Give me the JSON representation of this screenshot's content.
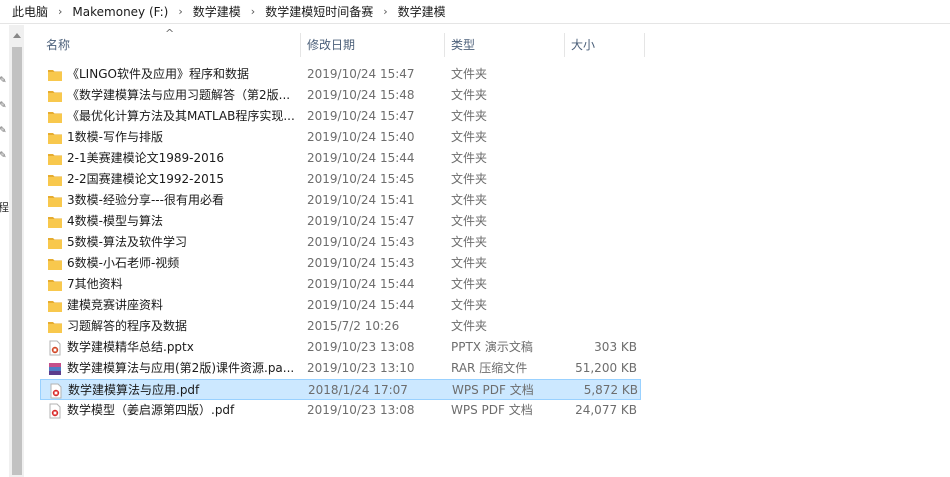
{
  "breadcrumb": {
    "items": [
      "此电脑",
      "Makemoney (F:)",
      "数学建模",
      "数学建模短时间备赛",
      "数学建模"
    ]
  },
  "side": {
    "partial_label": "程"
  },
  "columns": {
    "name": "名称",
    "modified": "修改日期",
    "type": "类型",
    "size": "大小"
  },
  "colors": {
    "folder": "#f8c84d",
    "folder_tab": "#e6ac2f",
    "selection_bg": "#cce8ff",
    "selection_border": "#99d1ff",
    "pdf_red": "#d92b2b",
    "rar_purple": "#5b3c8c",
    "header_text": "#4c607a"
  },
  "files": [
    {
      "icon": "folder-icon",
      "name": "《LINGO软件及应用》程序和数据",
      "modified": "2019/10/24 15:47",
      "type": "文件夹",
      "size": ""
    },
    {
      "icon": "folder-icon",
      "name": "《数学建模算法与应用习题解答（第2版...",
      "modified": "2019/10/24 15:48",
      "type": "文件夹",
      "size": ""
    },
    {
      "icon": "folder-icon",
      "name": "《最优化计算方法及其MATLAB程序实现...",
      "modified": "2019/10/24 15:47",
      "type": "文件夹",
      "size": ""
    },
    {
      "icon": "folder-icon",
      "name": "1数模-写作与排版",
      "modified": "2019/10/24 15:40",
      "type": "文件夹",
      "size": ""
    },
    {
      "icon": "folder-icon",
      "name": "2-1美赛建模论文1989-2016",
      "modified": "2019/10/24 15:44",
      "type": "文件夹",
      "size": ""
    },
    {
      "icon": "folder-icon",
      "name": "2-2国赛建模论文1992-2015",
      "modified": "2019/10/24 15:45",
      "type": "文件夹",
      "size": ""
    },
    {
      "icon": "folder-icon",
      "name": "3数模-经验分享---很有用必看",
      "modified": "2019/10/24 15:41",
      "type": "文件夹",
      "size": ""
    },
    {
      "icon": "folder-icon",
      "name": "4数模-模型与算法",
      "modified": "2019/10/24 15:47",
      "type": "文件夹",
      "size": ""
    },
    {
      "icon": "folder-icon",
      "name": "5数模-算法及软件学习",
      "modified": "2019/10/24 15:43",
      "type": "文件夹",
      "size": ""
    },
    {
      "icon": "folder-icon",
      "name": "6数模-小石老师-视频",
      "modified": "2019/10/24 15:43",
      "type": "文件夹",
      "size": ""
    },
    {
      "icon": "folder-icon",
      "name": "7其他资料",
      "modified": "2019/10/24 15:44",
      "type": "文件夹",
      "size": ""
    },
    {
      "icon": "folder-icon",
      "name": "建模竞赛讲座资料",
      "modified": "2019/10/24 15:44",
      "type": "文件夹",
      "size": ""
    },
    {
      "icon": "folder-icon",
      "name": "习题解答的程序及数据",
      "modified": "2015/7/2 10:26",
      "type": "文件夹",
      "size": ""
    },
    {
      "icon": "pptx-file-icon",
      "name": "数学建模精华总结.pptx",
      "modified": "2019/10/23 13:08",
      "type": "PPTX 演示文稿",
      "size": "303 KB"
    },
    {
      "icon": "rar-file-icon",
      "name": "数学建模算法与应用(第2版)课件资源.pa...",
      "modified": "2019/10/23 13:10",
      "type": "RAR 压缩文件",
      "size": "51,200 KB"
    },
    {
      "icon": "pdf-file-icon",
      "name": "数学建模算法与应用.pdf",
      "modified": "2018/1/24 17:07",
      "type": "WPS PDF 文档",
      "size": "5,872 KB",
      "selected": true
    },
    {
      "icon": "pdf-file-icon",
      "name": "数学模型（姜启源第四版）.pdf",
      "modified": "2019/10/23 13:08",
      "type": "WPS PDF 文档",
      "size": "24,077 KB"
    }
  ]
}
